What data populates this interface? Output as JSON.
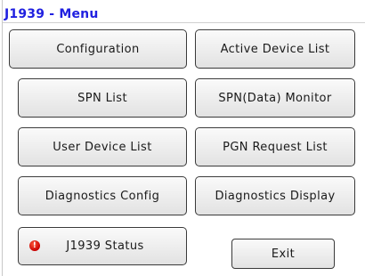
{
  "header": {
    "title": "J1939 - Menu"
  },
  "buttons": {
    "configuration": "Configuration",
    "active_device_list": "Active Device List",
    "spn_list": "SPN List",
    "spn_data_monitor": "SPN(Data) Monitor",
    "user_device_list": "User Device List",
    "pgn_request_list": "PGN Request List",
    "diagnostics_config": "Diagnostics Config",
    "diagnostics_display": "Diagnostics Display",
    "j1939_status": "J1939 Status",
    "exit": "Exit"
  },
  "status_indicator": {
    "glyph": "!",
    "color": "#d00000"
  }
}
